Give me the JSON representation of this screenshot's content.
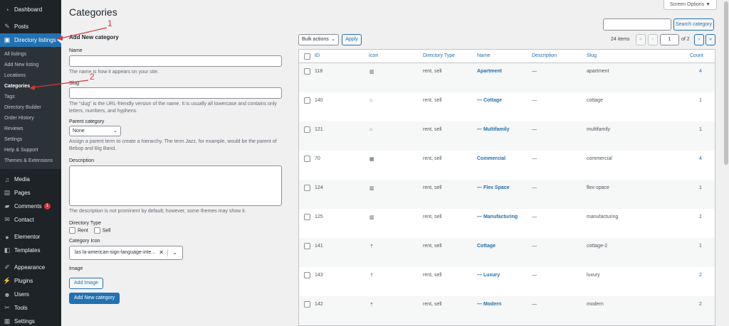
{
  "sidebar": {
    "dashboard": "Dashboard",
    "posts": "Posts",
    "directory_listings": "Directory listings",
    "submenu": [
      "All listings",
      "Add New listing",
      "Locations",
      "Categories",
      "Tags",
      "Directory Builder",
      "Order History",
      "Reviews",
      "Settings",
      "Help & Support",
      "Themes & Extensions"
    ],
    "media": "Media",
    "pages": "Pages",
    "comments": "Comments",
    "comments_badge": "1",
    "contact": "Contact",
    "elementor": "Elementor",
    "templates": "Templates",
    "appearance": "Appearance",
    "plugins": "Plugins",
    "users": "Users",
    "tools": "Tools",
    "settings": "Settings"
  },
  "header": {
    "title": "Categories",
    "screen_options": "Screen Options ▼",
    "search_button": "Search category"
  },
  "form": {
    "heading": "Add New category",
    "name_label": "Name",
    "name_help": "The name is how it appears on your site.",
    "slug_label": "Slug",
    "slug_help_1": "The “slug” is the URL-friendly version of the name. It is usually all lowercase and contains only",
    "slug_help_2": "letters, numbers, and hyphens.",
    "parent_label": "Parent category",
    "parent_value": "None",
    "parent_help_1": "Assign a parent term to create a hierarchy. The term Jazz, for example, would be the parent of",
    "parent_help_2": "Bebop and Big Band.",
    "description_label": "Description",
    "description_help": "The description is not prominent by default; however, some themes may show it.",
    "directory_type_label": "Directory Type",
    "type_rent": "Rent",
    "type_sell": "Sell",
    "category_icon_label": "Category Icon",
    "category_icon_value": "las la-american-sign-language-inte...",
    "image_label": "Image",
    "add_image": "Add Image",
    "submit": "Add New category"
  },
  "tablenav": {
    "bulk_actions": "Bulk actions",
    "apply": "Apply",
    "items_count": "24 items",
    "first": "«",
    "prev": "‹",
    "page": "1",
    "of": "of 2",
    "next": "›",
    "last": "»"
  },
  "table": {
    "columns": [
      "ID",
      "Icon",
      "Directory Type",
      "Name",
      "Description",
      "Slug",
      "Count"
    ],
    "rows": [
      {
        "id": "118",
        "icon": "▥",
        "type": "rent, sell",
        "name": "Apartment",
        "description": "—",
        "slug": "apartment",
        "count": "4"
      },
      {
        "id": "140",
        "icon": "⌂",
        "type": "rent, sell",
        "name": "— Cottage",
        "description": "—",
        "slug": "cottage",
        "count": "1"
      },
      {
        "id": "121",
        "icon": "⌂",
        "type": "rent, sell",
        "name": "— Multifamily",
        "description": "—",
        "slug": "multifamily",
        "count": "1"
      },
      {
        "id": "70",
        "icon": "▦",
        "type": "rent, sell",
        "name": "Commercial",
        "description": "—",
        "slug": "commercial",
        "count": "4"
      },
      {
        "id": "124",
        "icon": "▥",
        "type": "rent, sell",
        "name": "— Flex Space",
        "description": "—",
        "slug": "flex-space",
        "count": "1"
      },
      {
        "id": "125",
        "icon": "▥",
        "type": "rent, sell",
        "name": "— Manufacturing",
        "description": "—",
        "slug": "manufacturing",
        "count": "1"
      },
      {
        "id": "141",
        "icon": "⇡",
        "type": "rent, sell",
        "name": "Cottage",
        "description": "—",
        "slug": "cottage-2",
        "count": "1"
      },
      {
        "id": "143",
        "icon": "⇡",
        "type": "rent, sell",
        "name": "— Luxury",
        "description": "—",
        "slug": "luxury",
        "count": "2"
      },
      {
        "id": "142",
        "icon": "⇡",
        "type": "rent, sell",
        "name": "— Modern",
        "description": "—",
        "slug": "modern",
        "count": "2"
      }
    ]
  },
  "annotations": {
    "one": "1",
    "two": "2"
  },
  "colors": {
    "accent": "#2271b1",
    "sidebar": "#1d2327",
    "annotation": "#d63638"
  }
}
